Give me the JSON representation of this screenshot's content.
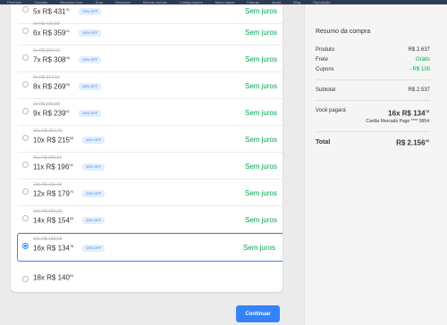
{
  "browser_bookmarks": [
    "Produtos",
    "Tutoriais",
    "Mercado Livre",
    "Área",
    "Recursos",
    "Minhas vendas",
    "Configurações",
    "Meus dados",
    "Faturas",
    "Ajuda",
    "Blog",
    "Reputação"
  ],
  "installments": [
    {
      "original": "5x R$ 431,51",
      "count": "5x",
      "amount": "R$ 431",
      "cents": "31",
      "discount": "15% OFF",
      "interest": "Sem juros",
      "selected": false
    },
    {
      "original": "6x R$ 422,83",
      "count": "6x",
      "amount": "R$ 359",
      "cents": "41",
      "discount": "15% OFF",
      "interest": "Sem juros",
      "selected": false
    },
    {
      "original": "7x R$ 362,43",
      "count": "7x",
      "amount": "R$ 308",
      "cents": "06",
      "discount": "15% OFF",
      "interest": "Sem juros",
      "selected": false
    },
    {
      "original": "8x R$ 317,13",
      "count": "8x",
      "amount": "R$ 269",
      "cents": "55",
      "discount": "15% OFF",
      "interest": "Sem juros",
      "selected": false
    },
    {
      "original": "9x R$ 281,89",
      "count": "9x",
      "amount": "R$ 239",
      "cents": "61",
      "discount": "15% OFF",
      "interest": "Sem juros",
      "selected": false
    },
    {
      "original": "10x R$ 253,70",
      "count": "10x",
      "amount": "R$ 215",
      "cents": "65",
      "discount": "15% OFF",
      "interest": "Sem juros",
      "selected": false
    },
    {
      "original": "11x R$ 230,64",
      "count": "11x",
      "amount": "R$ 196",
      "cents": "04",
      "discount": "15% OFF",
      "interest": "Sem juros",
      "selected": false
    },
    {
      "original": "12x R$ 211,42",
      "count": "12x",
      "amount": "R$ 179",
      "cents": "70",
      "discount": "15% OFF",
      "interest": "Sem juros",
      "selected": false
    },
    {
      "original": "14x R$ 181,21",
      "count": "14x",
      "amount": "R$ 154",
      "cents": "03",
      "discount": "15% OFF",
      "interest": "Sem juros",
      "selected": false
    },
    {
      "original": "16x R$ 158,56",
      "count": "16x",
      "amount": "R$ 134",
      "cents": "78",
      "discount": "15% OFF",
      "interest": "Sem juros",
      "selected": true
    },
    {
      "original": "",
      "count": "18x",
      "amount": "R$ 140",
      "cents": "94",
      "discount": "",
      "interest": "",
      "selected": false
    }
  ],
  "continue_label": "Continuar",
  "summary": {
    "title": "Resumo da compra",
    "produto_label": "Produto",
    "produto_value": "R$ 2.637",
    "frete_label": "Frete",
    "frete_value": "Grátis",
    "cupons_label": "Cupons",
    "cupons_value": "- R$ 100",
    "subtotal_label": "Subtotal",
    "subtotal_value": "R$ 2.537",
    "voce_pagara_label": "Você pagará",
    "voce_pagara_value": "16x R$ 134",
    "voce_pagara_cents": "78",
    "card_info": "Cartão Mercado Pago **** 9954",
    "total_label": "Total",
    "total_value": "R$ 2.156",
    "total_cents": "45"
  },
  "colors": {
    "accent": "#3483fa",
    "green": "#00a650",
    "badge_bg": "#e3edfb"
  }
}
